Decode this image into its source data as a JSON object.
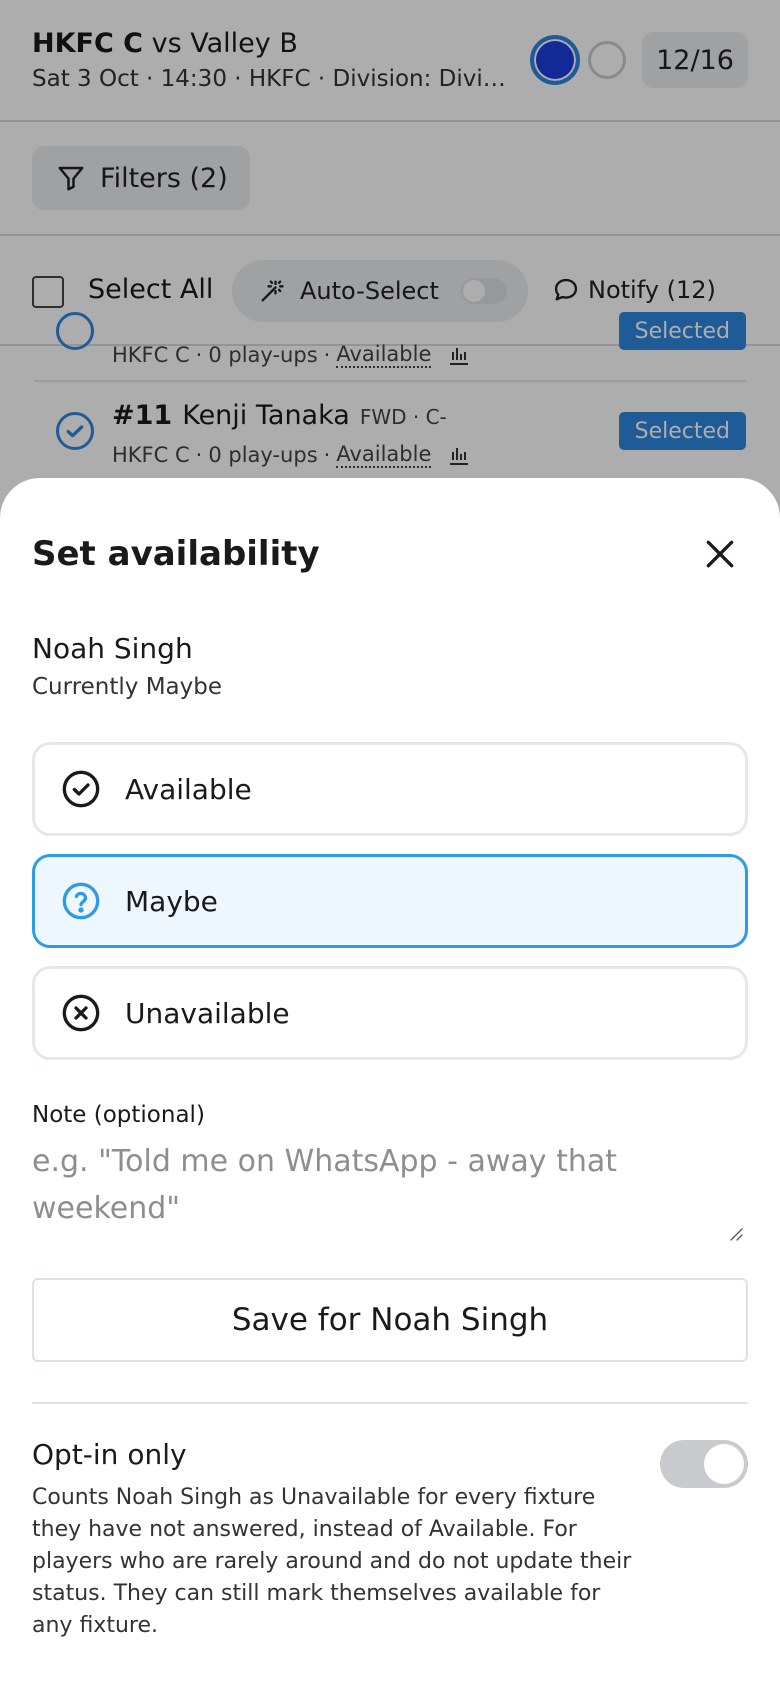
{
  "fixture": {
    "home_team": "HKFC C",
    "vs_text": "vs Valley B",
    "subtitle": "Sat 3 Oct · 14:30 · HKFC · Division: Divisio...",
    "count": "12/16"
  },
  "filters": {
    "label": "Filters (2)"
  },
  "selection_bar": {
    "select_all": "Select All",
    "auto_select": "Auto-Select",
    "notify": "Notify (12)"
  },
  "players": [
    {
      "number": "",
      "name": "",
      "position": "",
      "team": "HKFC C",
      "playups": "0 play-ups",
      "availability": "Available",
      "badge": "Selected"
    },
    {
      "number": "#11",
      "name": "Kenji Tanaka",
      "position": "FWD · C-",
      "team": "HKFC C",
      "playups": "0 play-ups",
      "availability": "Available",
      "badge": "Selected"
    }
  ],
  "sheet": {
    "title": "Set availability",
    "player_name": "Noah Singh",
    "current_status": "Currently Maybe",
    "options": [
      {
        "label": "Available",
        "icon": "check-circle-icon",
        "selected": false
      },
      {
        "label": "Maybe",
        "icon": "question-circle-icon",
        "selected": true
      },
      {
        "label": "Unavailable",
        "icon": "x-circle-icon",
        "selected": false
      }
    ],
    "note_label": "Note (optional)",
    "note_placeholder": "e.g. \"Told me on WhatsApp - away that weekend\"",
    "save_label": "Save for Noah Singh",
    "optin_title": "Opt-in only",
    "optin_description": "Counts Noah Singh as Unavailable for every fixture they have not answered, instead of Available. For players who are rarely around and do not update their status. They can still mark themselves available for any fixture.",
    "optin_enabled": false
  },
  "colors": {
    "accent": "#2e86de",
    "selected_option_border": "#2e9be6",
    "selected_option_bg": "#eef7fe",
    "status_dot": "#1a3fe0"
  }
}
